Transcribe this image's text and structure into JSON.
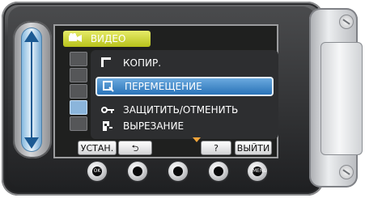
{
  "window": {
    "width": 451,
    "height": 245
  },
  "menu": {
    "tab_label": "ВИДЕО",
    "items": [
      {
        "label": "КОПИР.",
        "icon": "copy-icon"
      },
      {
        "label": "ПЕРЕМЕЩЕНИЕ",
        "icon": "move-icon",
        "selected": true
      },
      {
        "label": "ЗАЩИТИТЬ/ОТМЕНИТЬ",
        "icon": "key-icon"
      },
      {
        "label": "ВЫРЕЗАНИЕ",
        "icon": "trim-icon"
      }
    ]
  },
  "buttons": {
    "set": "УСТАН.",
    "back": "⮌",
    "help": "?",
    "exit": "ВЫЙТИ"
  },
  "hardware": {
    "ok": "OK",
    "menu": "MENU"
  },
  "colors": {
    "accent_blue": "#2a73b8",
    "tab_yellow": "#b8c21a"
  }
}
